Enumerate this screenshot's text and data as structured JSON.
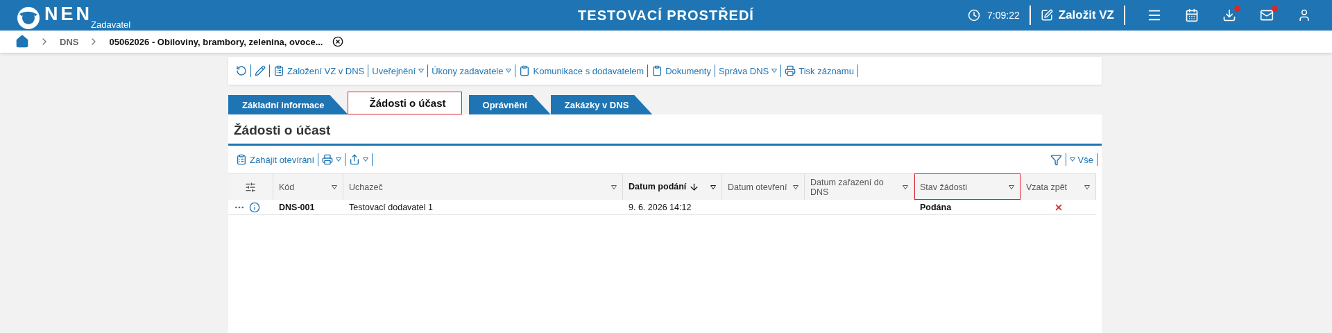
{
  "header": {
    "logo": "NEN",
    "role": "Zadavatel",
    "environment": "TESTOVACÍ PROSTŘEDÍ",
    "time": "7:09:22",
    "create_button": "Založit VZ",
    "icons": [
      {
        "kind": "menu",
        "badge": false
      },
      {
        "kind": "calendar",
        "badge": false
      },
      {
        "kind": "download",
        "badge": true
      },
      {
        "kind": "mail",
        "badge": true
      },
      {
        "kind": "user",
        "badge": false
      }
    ]
  },
  "breadcrumb": [
    "DNS",
    "05062026 - Obiloviny, brambory, zelenina, ovoce..."
  ],
  "toolbar": [
    {
      "kind": "refresh",
      "dropdown": false
    },
    {
      "kind": "edit",
      "dropdown": false
    },
    {
      "kind": "clipboard-gear",
      "label": "Založení VZ v DNS",
      "dropdown": false
    },
    {
      "label": "Uveřejnění",
      "dropdown": true
    },
    {
      "label": "Úkony zadavatele",
      "dropdown": true
    },
    {
      "kind": "clipboard",
      "label": "Komunikace s dodavatelem",
      "dropdown": false
    },
    {
      "kind": "clipboard",
      "label": "Dokumenty",
      "dropdown": false
    },
    {
      "label": "Správa DNS",
      "dropdown": true
    },
    {
      "kind": "print",
      "label": "Tisk záznamu",
      "dropdown": false
    }
  ],
  "tabs": [
    {
      "label": "Základní informace",
      "selected": false
    },
    {
      "label": "Žádosti o účast",
      "selected": true
    },
    {
      "label": "Oprávnění",
      "selected": false
    },
    {
      "label": "Zakázky v DNS",
      "selected": false
    }
  ],
  "section_title": "Žádosti o účast",
  "actions": [
    {
      "kind": "clipboard-gear",
      "label": "Zahájit otevírání",
      "dropdown": false
    },
    {
      "kind": "print",
      "dropdown": true
    },
    {
      "kind": "share",
      "dropdown": true
    }
  ],
  "filter": {
    "label": "Vše"
  },
  "table": {
    "columns": [
      {
        "label": "Kód",
        "sorted": false,
        "highlighted": false
      },
      {
        "label": "Uchazeč",
        "sorted": false,
        "highlighted": false
      },
      {
        "label": "Datum podání",
        "sorted": true,
        "highlighted": false
      },
      {
        "label": "Datum otevření",
        "sorted": false,
        "highlighted": false
      },
      {
        "label": "Datum zařazení do DNS",
        "sorted": false,
        "highlighted": false
      },
      {
        "label": "Stav žádosti",
        "sorted": false,
        "highlighted": true
      },
      {
        "label": "Vzata zpět",
        "sorted": false,
        "highlighted": false
      }
    ],
    "rows": [
      {
        "kod": "DNS-001",
        "uchazec": "Testovací dodavatel 1",
        "datum_podani": "9. 6. 2026 14:12",
        "stav": "Podána",
        "vzata_zpet": false
      }
    ]
  }
}
